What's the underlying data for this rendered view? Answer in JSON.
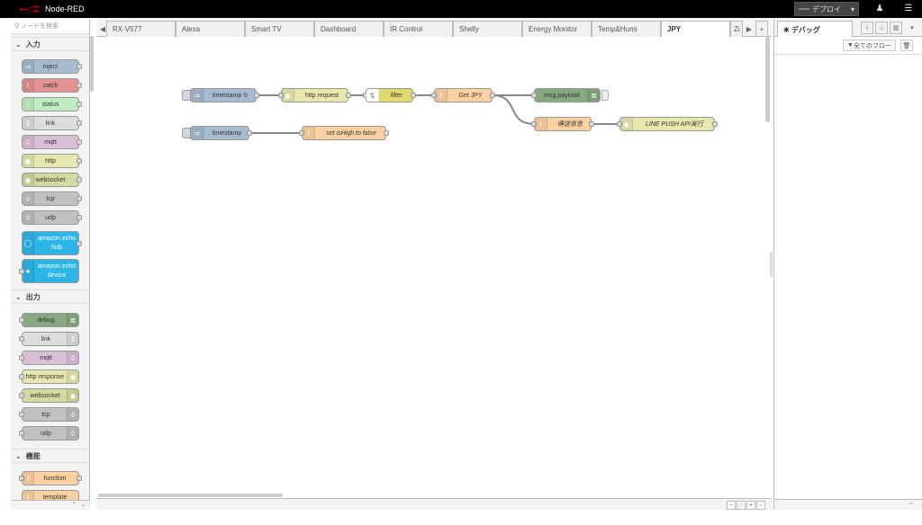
{
  "header": {
    "app_title": "Node-RED",
    "deploy_label": "デプロイ",
    "deploy_prefix": "▬▬"
  },
  "palette": {
    "search_placeholder": "ノードを検索",
    "categories": [
      {
        "label": "入力",
        "nodes": [
          "inject",
          "catch",
          "status",
          "link",
          "mqtt",
          "http",
          "websocket",
          "tcp",
          "udp",
          "amazon echo hub",
          "amazon echo device"
        ]
      },
      {
        "label": "出力",
        "nodes": [
          "debug",
          "link",
          "mqtt",
          "http response",
          "websocket",
          "tcp",
          "udp"
        ]
      },
      {
        "label": "機能",
        "nodes": [
          "function",
          "template"
        ]
      }
    ]
  },
  "tabs": [
    {
      "label": "RX-V577"
    },
    {
      "label": "Alexa"
    },
    {
      "label": "Smart TV"
    },
    {
      "label": "Dashboard"
    },
    {
      "label": "IR Control"
    },
    {
      "label": "Shelly"
    },
    {
      "label": "Energy Monitor"
    },
    {
      "label": "Temp&Humi"
    },
    {
      "label": "JPY",
      "active": true
    },
    {
      "label": "Zi"
    }
  ],
  "flow": {
    "nodes": {
      "timestamp_repeat": "timestamp ↻",
      "http_request": "http request",
      "filter": "filter",
      "get_jpy": "Get JPY",
      "msg_payload": "msg.payload",
      "message_info": "傳送信息",
      "line_push": "LINE PUSH API実行",
      "timestamp": "timestamp",
      "set_ishigh": "set isHigh to false"
    }
  },
  "sidebar": {
    "tab_label": "デバッグ",
    "filter_label": "全てのフロー"
  },
  "colors": {
    "inject": "#a6bbcf",
    "catch": "#e49191",
    "status": "#c0edc0",
    "link": "#dddddd",
    "mqtt": "#d8bfd8",
    "http": "#e7e7ae",
    "websocket": "#d7d7a0",
    "tcp": "#c0c0c0",
    "echo": "#3fadb5",
    "debug": "#87a980",
    "function": "#fdd0a2",
    "filter": "#e2d96e"
  }
}
